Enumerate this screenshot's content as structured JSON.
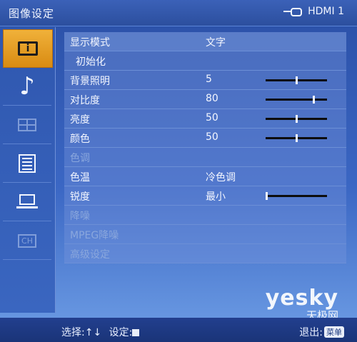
{
  "header": {
    "title": "图像设定",
    "source_label": "HDMI 1",
    "source_icon": "input-plug-icon"
  },
  "sidebar": {
    "items": [
      {
        "icon": "picture-icon",
        "active": true
      },
      {
        "icon": "music-note-icon",
        "active": false
      },
      {
        "icon": "grid-icon",
        "active": false
      },
      {
        "icon": "list-icon",
        "active": false
      },
      {
        "icon": "pc-laptop-icon",
        "active": false
      },
      {
        "icon": "channel-icon",
        "active": false
      }
    ],
    "channel_text": "CH"
  },
  "menu": {
    "rows": [
      {
        "label": "显示模式",
        "value": "文字"
      },
      {
        "label": "初始化",
        "value": ""
      },
      {
        "label": "背景照明",
        "value": "5",
        "slider": 0.5
      },
      {
        "label": "对比度",
        "value": "80",
        "slider": 0.8
      },
      {
        "label": "亮度",
        "value": "50",
        "slider": 0.5
      },
      {
        "label": "颜色",
        "value": "50",
        "slider": 0.5
      },
      {
        "label": "色调",
        "value": "",
        "disabled": true
      },
      {
        "label": "色温",
        "value": "冷色调"
      },
      {
        "label": "锐度",
        "value": "最小",
        "slider": 0.0
      },
      {
        "label": "降噪",
        "value": "",
        "disabled": true
      },
      {
        "label": "MPEG降噪",
        "value": "",
        "disabled": true
      },
      {
        "label": "高级设定",
        "value": "",
        "disabled": true
      }
    ]
  },
  "footer": {
    "select_hint": "选择:",
    "select_arrows": "↑↓",
    "set_hint": "设定:",
    "exit_label": "退出:",
    "menu_key": "菜单"
  },
  "watermark": {
    "brand": "yesky",
    "sub": "天极网"
  }
}
